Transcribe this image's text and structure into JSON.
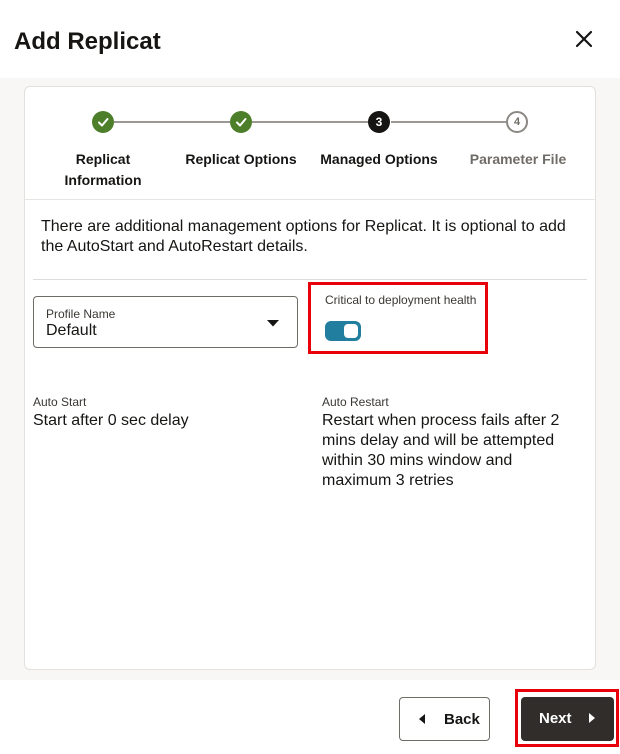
{
  "dialog": {
    "title": "Add Replicat",
    "close_icon": "close-icon"
  },
  "train": {
    "steps": [
      {
        "label_line1": "Replicat",
        "label_line2": "Information",
        "state": "done",
        "icon": "check-icon"
      },
      {
        "label_line1": "Replicat Options",
        "label_line2": "",
        "state": "done",
        "icon": "check-icon"
      },
      {
        "label_line1": "Managed Options",
        "label_line2": "",
        "state": "current",
        "number": "3"
      },
      {
        "label_line1": "Parameter File",
        "label_line2": "",
        "state": "future",
        "number": "4"
      }
    ]
  },
  "description": "There are additional management options for Replicat. It is optional to add the AutoStart and AutoRestart details.",
  "profile": {
    "label": "Profile Name",
    "value": "Default"
  },
  "critical": {
    "label": "Critical to deployment health",
    "enabled": true
  },
  "auto_start": {
    "label": "Auto Start",
    "value": "Start after 0 sec delay"
  },
  "auto_restart": {
    "label": "Auto Restart",
    "value": "Restart when process fails after 2 mins delay and will be attempted within 30 mins window and maximum 3 retries"
  },
  "footer": {
    "back_label": "Back",
    "next_label": "Next"
  },
  "colors": {
    "done": "#4d7f2a",
    "current": "#161513",
    "toggle": "#227e9e",
    "primary_button": "#312d2a",
    "highlight": "#e8000a"
  }
}
